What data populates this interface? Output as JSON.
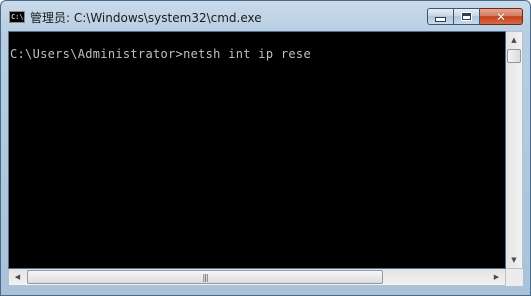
{
  "window": {
    "title": "管理员: C:\\Windows\\system32\\cmd.exe",
    "app_icon_text": "C:\\"
  },
  "caption_buttons": {
    "close_glyph": "✕"
  },
  "console": {
    "lines": [
      "C:\\Users\\Administrator>netsh int ip rese"
    ]
  },
  "scrollbars": {
    "up_arrow": "▲",
    "down_arrow": "▼",
    "left_arrow": "◀",
    "right_arrow": "▶",
    "grip": "|||"
  },
  "colors": {
    "console_bg": "#000000",
    "console_text": "#C0C0C0",
    "close_button": "#C4401C"
  }
}
